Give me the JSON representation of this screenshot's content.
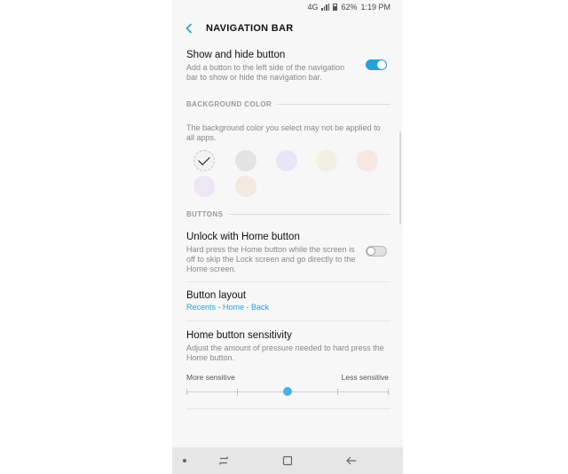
{
  "status_bar": {
    "network": "4G",
    "battery": "62%",
    "time": "1:19 PM"
  },
  "header": {
    "title": "NAVIGATION BAR"
  },
  "show_hide": {
    "title": "Show and hide button",
    "description": "Add a button to the left side of the navigation bar to show or hide the navigation bar.",
    "enabled": true
  },
  "background_color": {
    "label": "BACKGROUND COLOR",
    "description": "The background color you select may not be applied to all apps.",
    "swatches": [
      "#f2f2f2",
      "#e3e3e3",
      "#e6e6f6",
      "#f0f1e4",
      "#f6e6e6",
      "#ede6f5",
      "#f2e9e1"
    ],
    "selected_index": 0
  },
  "buttons": {
    "label": "BUTTONS"
  },
  "unlock_home": {
    "title": "Unlock with Home button",
    "description": "Hard press the Home button while the screen is off to skip the Lock screen and go directly to the Home screen.",
    "enabled": false
  },
  "button_layout": {
    "title": "Button layout",
    "value": "Recents - Home - Back"
  },
  "sensitivity": {
    "title": "Home button sensitivity",
    "description": "Adjust the amount of pressure needed to hard press the Home button.",
    "min_label": "More sensitive",
    "max_label": "Less sensitive",
    "steps": 5,
    "level": 2
  },
  "colors": {
    "accent": "#2a9fd6",
    "thumb": "#4ab0e6"
  }
}
